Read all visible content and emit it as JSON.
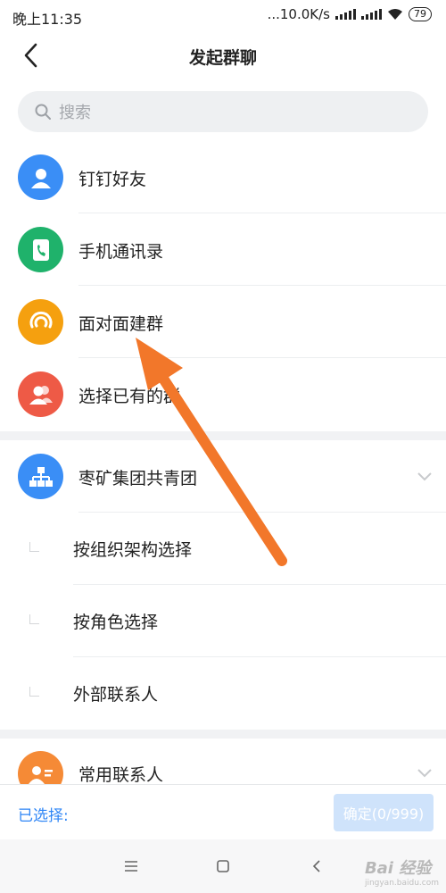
{
  "status_bar": {
    "time": "晚上11:35",
    "network_speed": "...10.0K/s",
    "battery": "79"
  },
  "header": {
    "title": "发起群聊",
    "back_icon": "chevron-left-icon"
  },
  "search": {
    "placeholder": "搜索"
  },
  "contact_sources": [
    {
      "label": "钉钉好友",
      "icon": "person-icon",
      "color": "#3a8ef6"
    },
    {
      "label": "手机通讯录",
      "icon": "phone-book-icon",
      "color": "#1fb26b"
    },
    {
      "label": "面对面建群",
      "icon": "radar-icon",
      "color": "#f5a00f"
    },
    {
      "label": "选择已有的群",
      "icon": "group-icon",
      "color": "#ee5a46"
    }
  ],
  "organization": {
    "name": "枣矿集团共青团",
    "icon": "org-chart-icon",
    "color": "#3a8ef6",
    "options": [
      {
        "label": "按组织架构选择"
      },
      {
        "label": "按角色选择"
      },
      {
        "label": "外部联系人"
      }
    ]
  },
  "frequent_contacts": {
    "label": "常用联系人",
    "icon": "contact-card-icon",
    "color": "#f58a36"
  },
  "footer": {
    "selected_label": "已选择:",
    "confirm_label": "确定(0/999)"
  },
  "watermark": {
    "brand": "Bai 经验",
    "url": "jingyan.baidu.com"
  },
  "colors": {
    "accent": "#2f86f6",
    "annotation_arrow": "#f2772a"
  }
}
